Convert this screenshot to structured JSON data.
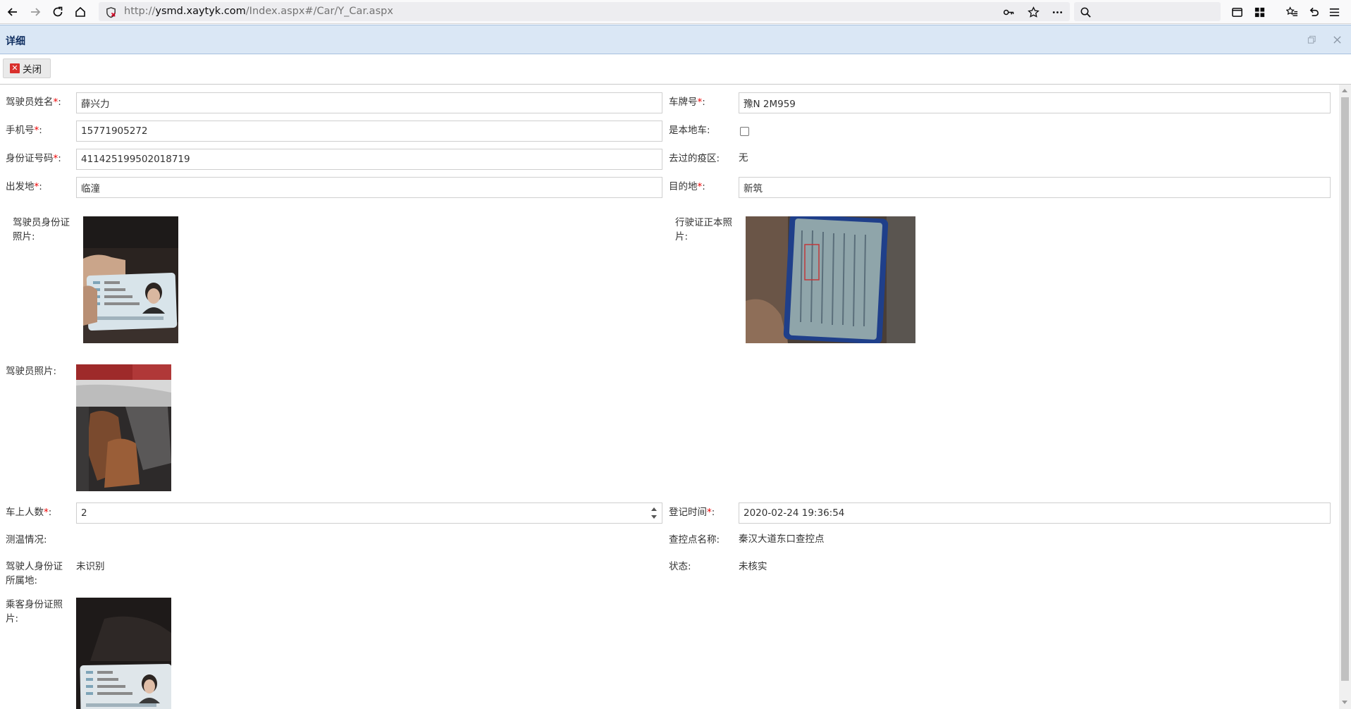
{
  "browser": {
    "url_scheme": "http://",
    "url_host": "ysmd.xaytyk.com",
    "url_path": "/Index.aspx#/Car/Y_Car.aspx"
  },
  "window": {
    "title": "详细",
    "close_button_label": "关闭"
  },
  "form": {
    "driver_name": {
      "label": "驾驶员姓名",
      "required_mark": "*",
      "colon": ":",
      "value": "薛兴力"
    },
    "plate_no": {
      "label": "车牌号",
      "required_mark": "*",
      "colon": ":",
      "value": "豫N 2M959"
    },
    "phone": {
      "label": "手机号",
      "required_mark": "*",
      "colon": ":",
      "value": "15771905272"
    },
    "is_local": {
      "label": "是本地车:",
      "checked": false
    },
    "id_number": {
      "label": "身份证号码",
      "required_mark": "*",
      "colon": ":",
      "value": "411425199502018719"
    },
    "visited_area": {
      "label": "去过的疫区:",
      "value": "无"
    },
    "origin": {
      "label": "出发地",
      "required_mark": "*",
      "colon": ":",
      "value": "临潼"
    },
    "destination": {
      "label": "目的地",
      "required_mark": "*",
      "colon": ":",
      "value": "新筑"
    },
    "driver_id_photo": {
      "label": "驾驶员身份证照片:"
    },
    "license_photo": {
      "label": "行驶证正本照片:"
    },
    "driver_photo": {
      "label": "驾驶员照片:"
    },
    "passenger_count": {
      "label": "车上人数",
      "required_mark": "*",
      "colon": ":",
      "value": "2"
    },
    "register_time": {
      "label": "登记时间",
      "required_mark": "*",
      "colon": ":",
      "value": "2020-02-24 19:36:54"
    },
    "temperature": {
      "label": "测温情况:",
      "value": ""
    },
    "checkpoint": {
      "label": "查控点名称:",
      "value": "秦汉大道东口查控点"
    },
    "id_origin": {
      "label": "驾驶人身份证所属地:",
      "value": "未识别"
    },
    "status": {
      "label": "状态:",
      "value": "未核实"
    },
    "passenger_id_photo": {
      "label": "乘客身份证照片:"
    }
  }
}
